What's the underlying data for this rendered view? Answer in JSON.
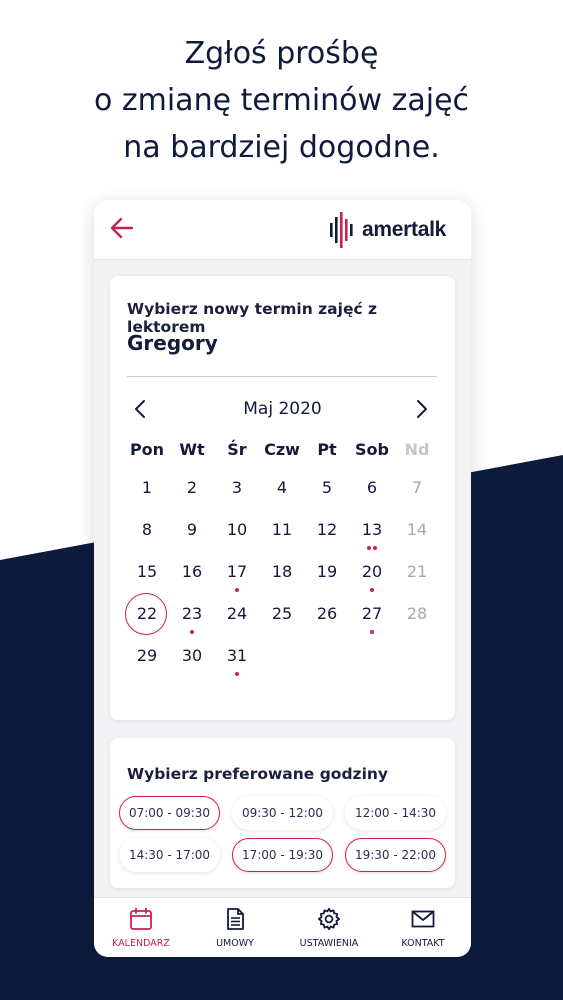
{
  "headline": [
    "Zgłoś prośbę",
    "o zmianę terminów zajęć",
    "na bardziej dogodne."
  ],
  "brand": {
    "name": "amertalk",
    "accent": "#c8234f",
    "dark": "#0e1b3d"
  },
  "calendar": {
    "intro": "Wybierz nowy termin zajęć z lektorem",
    "teacher": "Gregory",
    "month": "Maj 2020",
    "weekdays": [
      "Pon",
      "Wt",
      "Śr",
      "Czw",
      "Pt",
      "Sob",
      "Nd"
    ],
    "days": [
      {
        "n": "1",
        "dots": 0
      },
      {
        "n": "2",
        "dots": 0
      },
      {
        "n": "3",
        "dots": 0
      },
      {
        "n": "4",
        "dots": 0
      },
      {
        "n": "5",
        "dots": 0
      },
      {
        "n": "6",
        "dots": 0
      },
      {
        "n": "7",
        "dots": 0
      },
      {
        "n": "8",
        "dots": 0
      },
      {
        "n": "9",
        "dots": 0
      },
      {
        "n": "10",
        "dots": 0
      },
      {
        "n": "11",
        "dots": 0
      },
      {
        "n": "12",
        "dots": 0
      },
      {
        "n": "13",
        "dots": 2
      },
      {
        "n": "14",
        "dots": 0
      },
      {
        "n": "15",
        "dots": 0
      },
      {
        "n": "16",
        "dots": 0
      },
      {
        "n": "17",
        "dots": 1
      },
      {
        "n": "18",
        "dots": 0
      },
      {
        "n": "19",
        "dots": 0
      },
      {
        "n": "20",
        "dots": 1
      },
      {
        "n": "21",
        "dots": 0
      },
      {
        "n": "22",
        "dots": 0,
        "selected": true
      },
      {
        "n": "23",
        "dots": 1
      },
      {
        "n": "24",
        "dots": 0
      },
      {
        "n": "25",
        "dots": 0
      },
      {
        "n": "26",
        "dots": 0
      },
      {
        "n": "27",
        "dots": 1
      },
      {
        "n": "28",
        "dots": 0
      },
      {
        "n": "29",
        "dots": 0
      },
      {
        "n": "30",
        "dots": 0
      },
      {
        "n": "31",
        "dots": 1
      }
    ]
  },
  "hours": {
    "title": "Wybierz preferowane godziny",
    "slots": [
      {
        "label": "07:00 - 09:30",
        "active": true
      },
      {
        "label": "09:30 - 12:00",
        "active": false
      },
      {
        "label": "12:00 - 14:30",
        "active": false
      },
      {
        "label": "14:30 - 17:00",
        "active": false
      },
      {
        "label": "17:00 - 19:30",
        "active": true
      },
      {
        "label": "19:30 - 22:00",
        "active": true
      }
    ]
  },
  "nav": [
    {
      "label": "KALENDARZ",
      "icon": "calendar-icon",
      "active": true
    },
    {
      "label": "UMOWY",
      "icon": "document-icon",
      "active": false
    },
    {
      "label": "USTAWIENIA",
      "icon": "gear-icon",
      "active": false
    },
    {
      "label": "KONTAKT",
      "icon": "envelope-icon",
      "active": false
    }
  ]
}
